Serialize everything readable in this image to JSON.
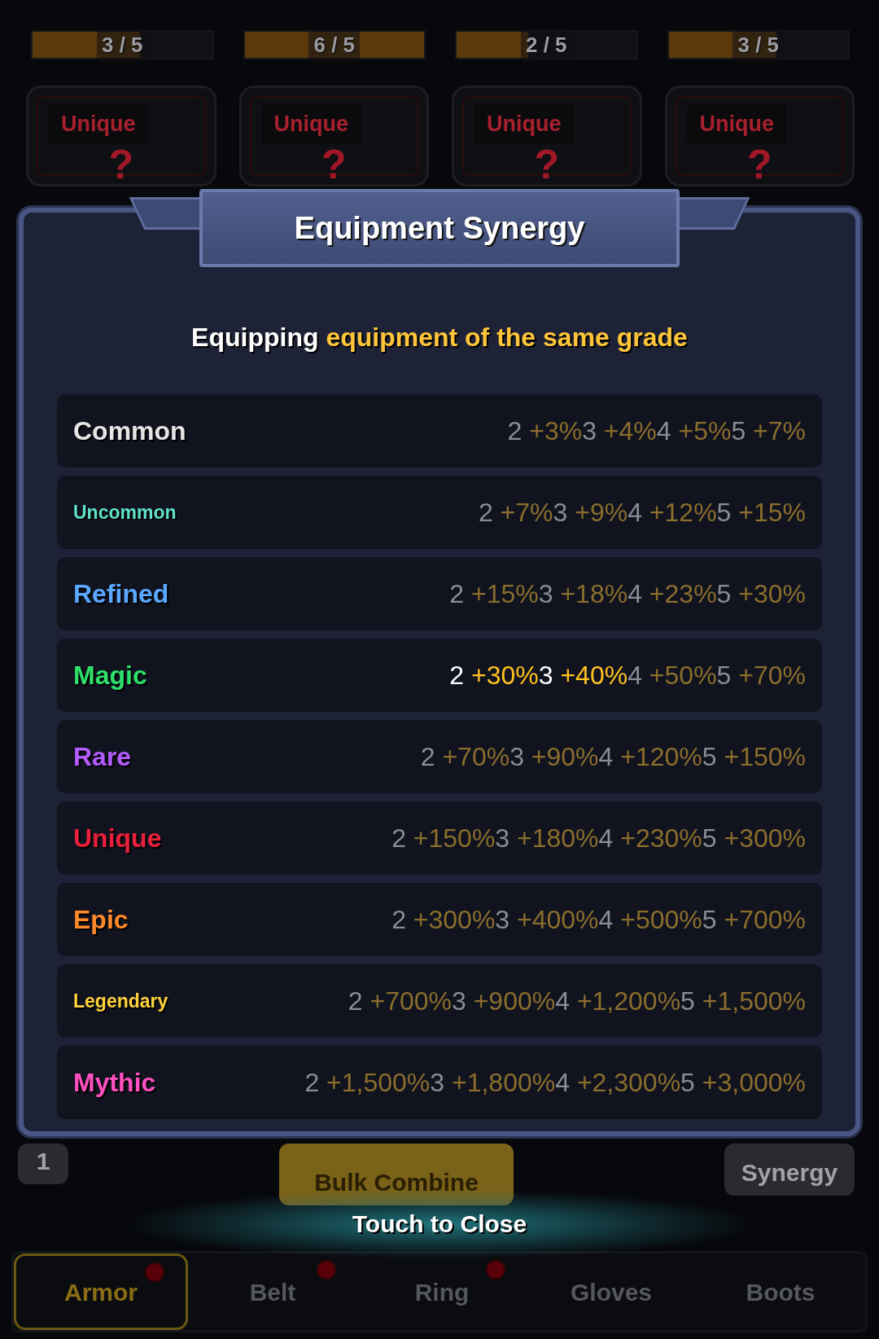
{
  "slots": [
    {
      "reading": "3 / 5",
      "level": 0.6
    },
    {
      "reading": "6 / 5",
      "level": 1
    },
    {
      "reading": "2 / 5",
      "level": 0.4
    },
    {
      "reading": "3 / 5",
      "level": 0.6
    }
  ],
  "cards": [
    {
      "grade": "Unique",
      "symbol": "?"
    },
    {
      "grade": "Unique",
      "symbol": "?"
    },
    {
      "grade": "Unique",
      "symbol": "?"
    },
    {
      "grade": "Unique",
      "symbol": "?"
    }
  ],
  "dialog": {
    "title": "Equipment Synergy",
    "subtitle": "Equipping **equipment of the same grade**",
    "grades": [
      {
        "name": "Common",
        "color": "#e6e6e6",
        "tiers": [
          {
            "count": "2",
            "bonus": "+3%",
            "active": false
          },
          {
            "count": "3",
            "bonus": "+4%",
            "active": false
          },
          {
            "count": "4",
            "bonus": "+5%",
            "active": false
          },
          {
            "count": "5",
            "bonus": "+7%",
            "active": false
          }
        ]
      },
      {
        "name": "Uncommon",
        "color": "#5fe0c8",
        "tiers": [
          {
            "count": "2",
            "bonus": "+7%",
            "active": false
          },
          {
            "count": "3",
            "bonus": "+9%",
            "active": false
          },
          {
            "count": "4",
            "bonus": "+12%",
            "active": false
          },
          {
            "count": "5",
            "bonus": "+15%",
            "active": false
          }
        ]
      },
      {
        "name": "Refined",
        "color": "#5aa8ff",
        "tiers": [
          {
            "count": "2",
            "bonus": "+15%",
            "active": false
          },
          {
            "count": "3",
            "bonus": "+18%",
            "active": false
          },
          {
            "count": "4",
            "bonus": "+23%",
            "active": false
          },
          {
            "count": "5",
            "bonus": "+30%",
            "active": false
          }
        ]
      },
      {
        "name": "Magic",
        "color": "#2ee06a",
        "tiers": [
          {
            "count": "2",
            "bonus": "+30%",
            "active": true
          },
          {
            "count": "3",
            "bonus": "+40%",
            "active": true
          },
          {
            "count": "4",
            "bonus": "+50%",
            "active": false
          },
          {
            "count": "5",
            "bonus": "+70%",
            "active": false
          }
        ]
      },
      {
        "name": "Rare",
        "color": "#b45cff",
        "tiers": [
          {
            "count": "2",
            "bonus": "+70%",
            "active": false
          },
          {
            "count": "3",
            "bonus": "+90%",
            "active": false
          },
          {
            "count": "4",
            "bonus": "+120%",
            "active": false
          },
          {
            "count": "5",
            "bonus": "+150%",
            "active": false
          }
        ]
      },
      {
        "name": "Unique",
        "color": "#e8203c",
        "tiers": [
          {
            "count": "2",
            "bonus": "+150%",
            "active": false
          },
          {
            "count": "3",
            "bonus": "+180%",
            "active": false
          },
          {
            "count": "4",
            "bonus": "+230%",
            "active": false
          },
          {
            "count": "5",
            "bonus": "+300%",
            "active": false
          }
        ]
      },
      {
        "name": "Epic",
        "color": "#ff8a2a",
        "tiers": [
          {
            "count": "2",
            "bonus": "+300%",
            "active": false
          },
          {
            "count": "3",
            "bonus": "+400%",
            "active": false
          },
          {
            "count": "4",
            "bonus": "+500%",
            "active": false
          },
          {
            "count": "5",
            "bonus": "+700%",
            "active": false
          }
        ]
      },
      {
        "name": "Legendary",
        "color": "#ffd23a",
        "tiers": [
          {
            "count": "2",
            "bonus": "+700%",
            "active": false
          },
          {
            "count": "3",
            "bonus": "+900%",
            "active": false
          },
          {
            "count": "4",
            "bonus": "+1,200%",
            "active": false
          },
          {
            "count": "5",
            "bonus": "+1,500%",
            "active": false
          }
        ]
      },
      {
        "name": "Mythic",
        "color": "#ff4fc0",
        "tiers": [
          {
            "count": "2",
            "bonus": "+1,500%",
            "active": false
          },
          {
            "count": "3",
            "bonus": "+1,800%",
            "active": false
          },
          {
            "count": "4",
            "bonus": "+2,300%",
            "active": false
          },
          {
            "count": "5",
            "bonus": "+3,000%",
            "active": false
          }
        ]
      }
    ]
  },
  "buttons": [
    {
      "label": "1",
      "kind": "small"
    },
    {
      "label": "Bulk Combine",
      "kind": "primary"
    },
    {
      "label": "Synergy",
      "kind": "secondary"
    }
  ],
  "close_hint": "Touch to Close",
  "tabs": [
    {
      "label": "Armor",
      "selected": true,
      "alert": true
    },
    {
      "label": "Belt",
      "selected": false,
      "alert": true
    },
    {
      "label": "Ring",
      "selected": false,
      "alert": true
    },
    {
      "label": "Gloves",
      "selected": false,
      "alert": false
    },
    {
      "label": "Boots",
      "selected": false,
      "alert": false
    }
  ]
}
